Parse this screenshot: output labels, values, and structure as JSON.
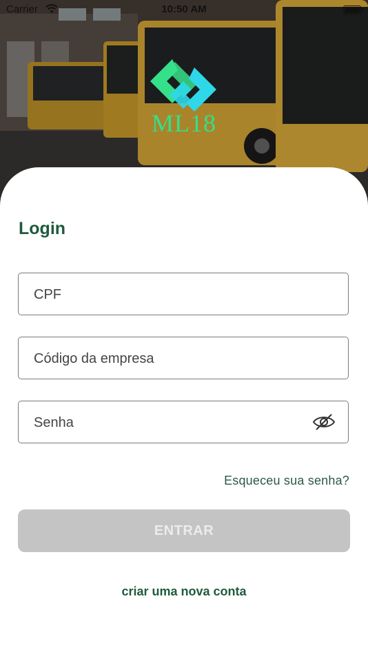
{
  "status_bar": {
    "carrier": "Carrier",
    "time": "10:50 AM"
  },
  "brand": {
    "logo_text": "ML18",
    "colors": {
      "green": "#35e08a",
      "cyan": "#2fd8e8",
      "accent": "#1f5a3d"
    }
  },
  "login": {
    "title": "Login",
    "cpf_placeholder": "CPF",
    "company_code_placeholder": "Código da empresa",
    "password_placeholder": "Senha",
    "password_toggle_icon": "eye-slash-icon",
    "forgot_password": "Esqueceu sua senha?",
    "submit_label": "ENTRAR",
    "create_account": "criar uma nova conta"
  }
}
